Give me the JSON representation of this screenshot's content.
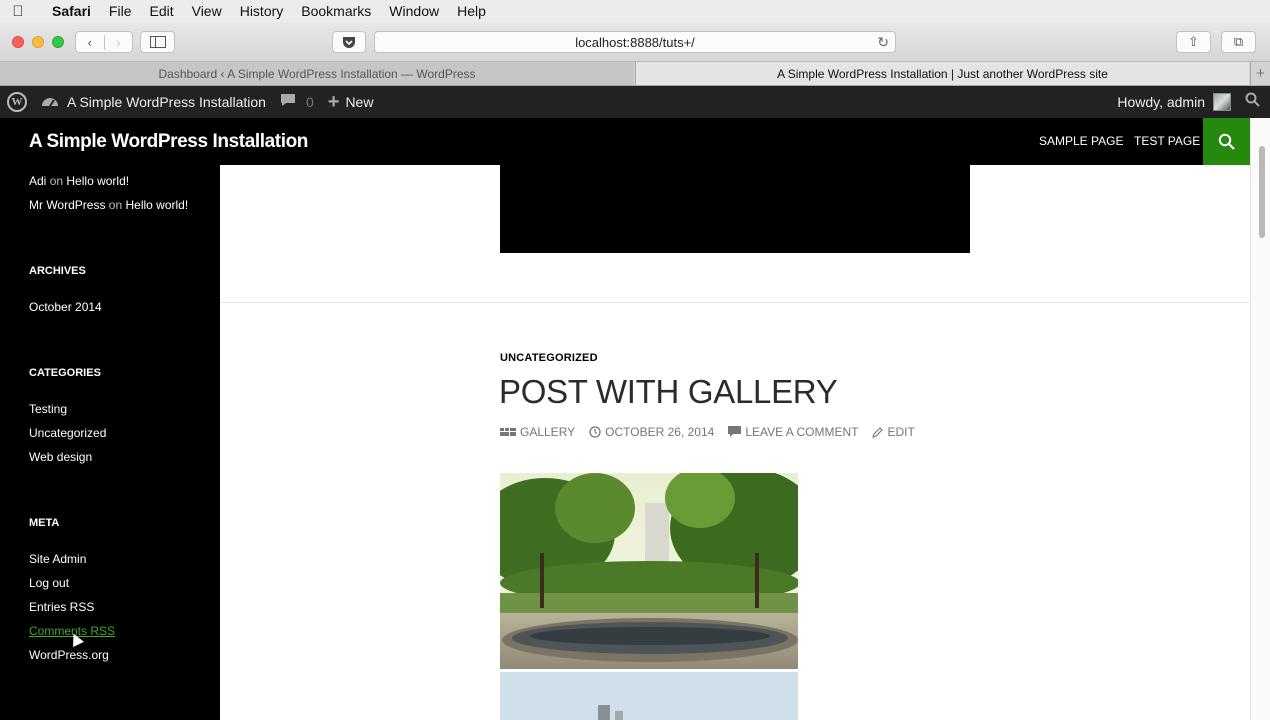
{
  "menubar": {
    "apple": "",
    "items": [
      "Safari",
      "File",
      "Edit",
      "View",
      "History",
      "Bookmarks",
      "Window",
      "Help"
    ]
  },
  "toolbar": {
    "back": "‹",
    "forward": "›",
    "sidebar_icon": "sidebar-icon",
    "pocket_icon": "pocket-icon",
    "url": "localhost:8888/tuts+/",
    "reload": "↻",
    "share": "⇧",
    "tabs": "⧉"
  },
  "tabs": [
    {
      "label": "Dashboard ‹ A Simple WordPress Installation — WordPress",
      "active": false
    },
    {
      "label": "A Simple WordPress Installation | Just another WordPress site",
      "active": true
    }
  ],
  "newtab": "+",
  "adminbar": {
    "site_name": "A Simple WordPress Installation",
    "comments_count": "0",
    "new_label": "New",
    "howdy": "Howdy, admin"
  },
  "site": {
    "title": "A Simple WordPress Installation",
    "nav": [
      "SAMPLE PAGE",
      "TEST PAGE"
    ],
    "accent": "#24890d"
  },
  "sidebar": {
    "recent_comments": [
      {
        "author": "Adi",
        "on": "on",
        "post": "Hello world!"
      },
      {
        "author": "Mr WordPress",
        "on": "on",
        "post": "Hello world!"
      }
    ],
    "archives_title": "ARCHIVES",
    "archives": [
      "October 2014"
    ],
    "categories_title": "CATEGORIES",
    "categories": [
      "Testing",
      "Uncategorized",
      "Web design"
    ],
    "meta_title": "META",
    "meta": [
      "Site Admin",
      "Log out",
      "Entries RSS",
      "Comments RSS",
      "WordPress.org"
    ]
  },
  "post": {
    "category": "UNCATEGORIZED",
    "title": "POST WITH GALLERY",
    "format": "GALLERY",
    "date": "OCTOBER 26, 2014",
    "comment": "LEAVE A COMMENT",
    "edit": "EDIT"
  }
}
